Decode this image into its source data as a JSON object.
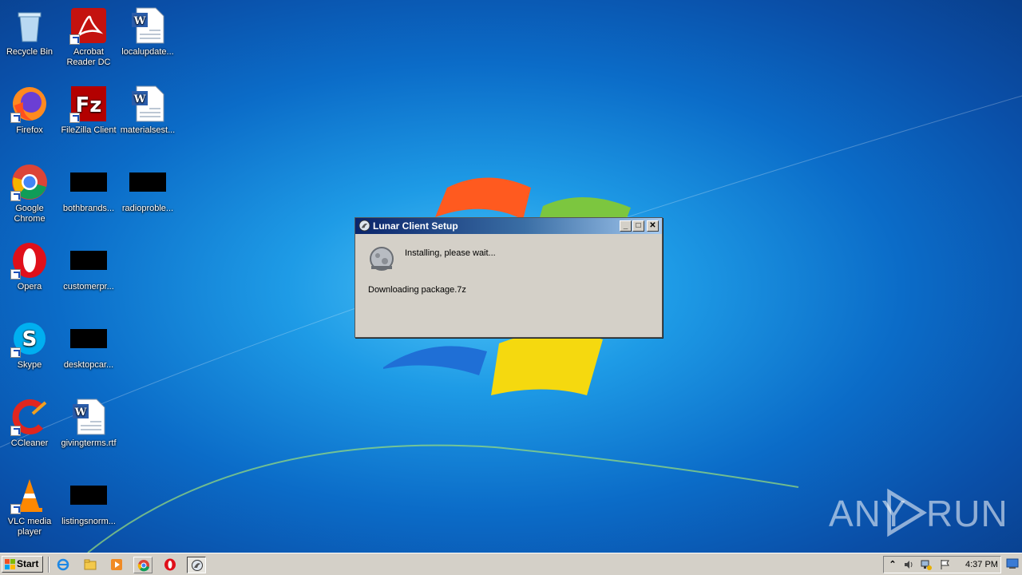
{
  "desktop_icons": [
    {
      "label": "Recycle Bin"
    },
    {
      "label": "Acrobat\nReader DC"
    },
    {
      "label": "localupdate..."
    },
    {
      "label": "Firefox"
    },
    {
      "label": "FileZilla Client"
    },
    {
      "label": "materialsest..."
    },
    {
      "label": "Google\nChrome"
    },
    {
      "label": "bothbrands..."
    },
    {
      "label": "radioproble..."
    },
    {
      "label": "Opera"
    },
    {
      "label": "customerpr..."
    },
    {
      "label": "Skype"
    },
    {
      "label": "desktopcar..."
    },
    {
      "label": "CCleaner"
    },
    {
      "label": "givingterms.rtf"
    },
    {
      "label": "VLC media\nplayer"
    },
    {
      "label": "listingsnorm..."
    }
  ],
  "dialog": {
    "title": "Lunar Client Setup",
    "install_status": "Installing, please wait...",
    "download_status": "Downloading package.7z",
    "minimize_glyph": "_",
    "maximize_glyph": "□",
    "close_glyph": "✕"
  },
  "taskbar": {
    "start_label": "Start",
    "clock": "4:37 PM"
  },
  "watermark": {
    "left_text": "ANY",
    "right_text": "RUN"
  },
  "colors": {
    "title_bar_start": "#0a246a",
    "title_bar_end": "#a6caf0",
    "dialog_face": "#d4d0c8"
  }
}
